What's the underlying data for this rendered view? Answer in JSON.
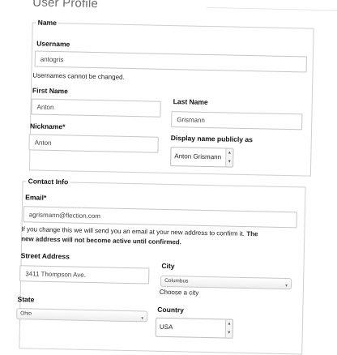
{
  "page": {
    "title": "User Profile"
  },
  "name_section": {
    "legend": "Name",
    "username_label": "Username",
    "username_value": "antogris",
    "username_help": "Usernames cannot be changed.",
    "first_name_label": "First Name",
    "first_name_value": "Anton",
    "last_name_label": "Last Name",
    "last_name_value": "Grismann",
    "nickname_label": "Nickname*",
    "nickname_value": "Anton",
    "display_name_label": "Display name publicly as",
    "display_name_value": "Anton Grismann"
  },
  "contact_section": {
    "legend": "Contact Info",
    "email_label": "Email*",
    "email_value": "agrismann@flection.com",
    "email_help": "If you change this we will send you an email at your new address to confirm it.",
    "email_help_bold_1": "The",
    "email_help_bold_2": "new address will not become active until confirmed.",
    "street_label": "Street Address",
    "street_value": "3411 Thompson Ave.",
    "city_label": "City",
    "city_value": "Columbus",
    "city_help": "Choose a city",
    "state_label": "State",
    "state_value": "Ohio",
    "country_label": "Country",
    "country_value": "USA"
  },
  "icons": {
    "select_caret": "chevron-down-icon",
    "popup_stepper": "up-down-arrows-icon"
  }
}
